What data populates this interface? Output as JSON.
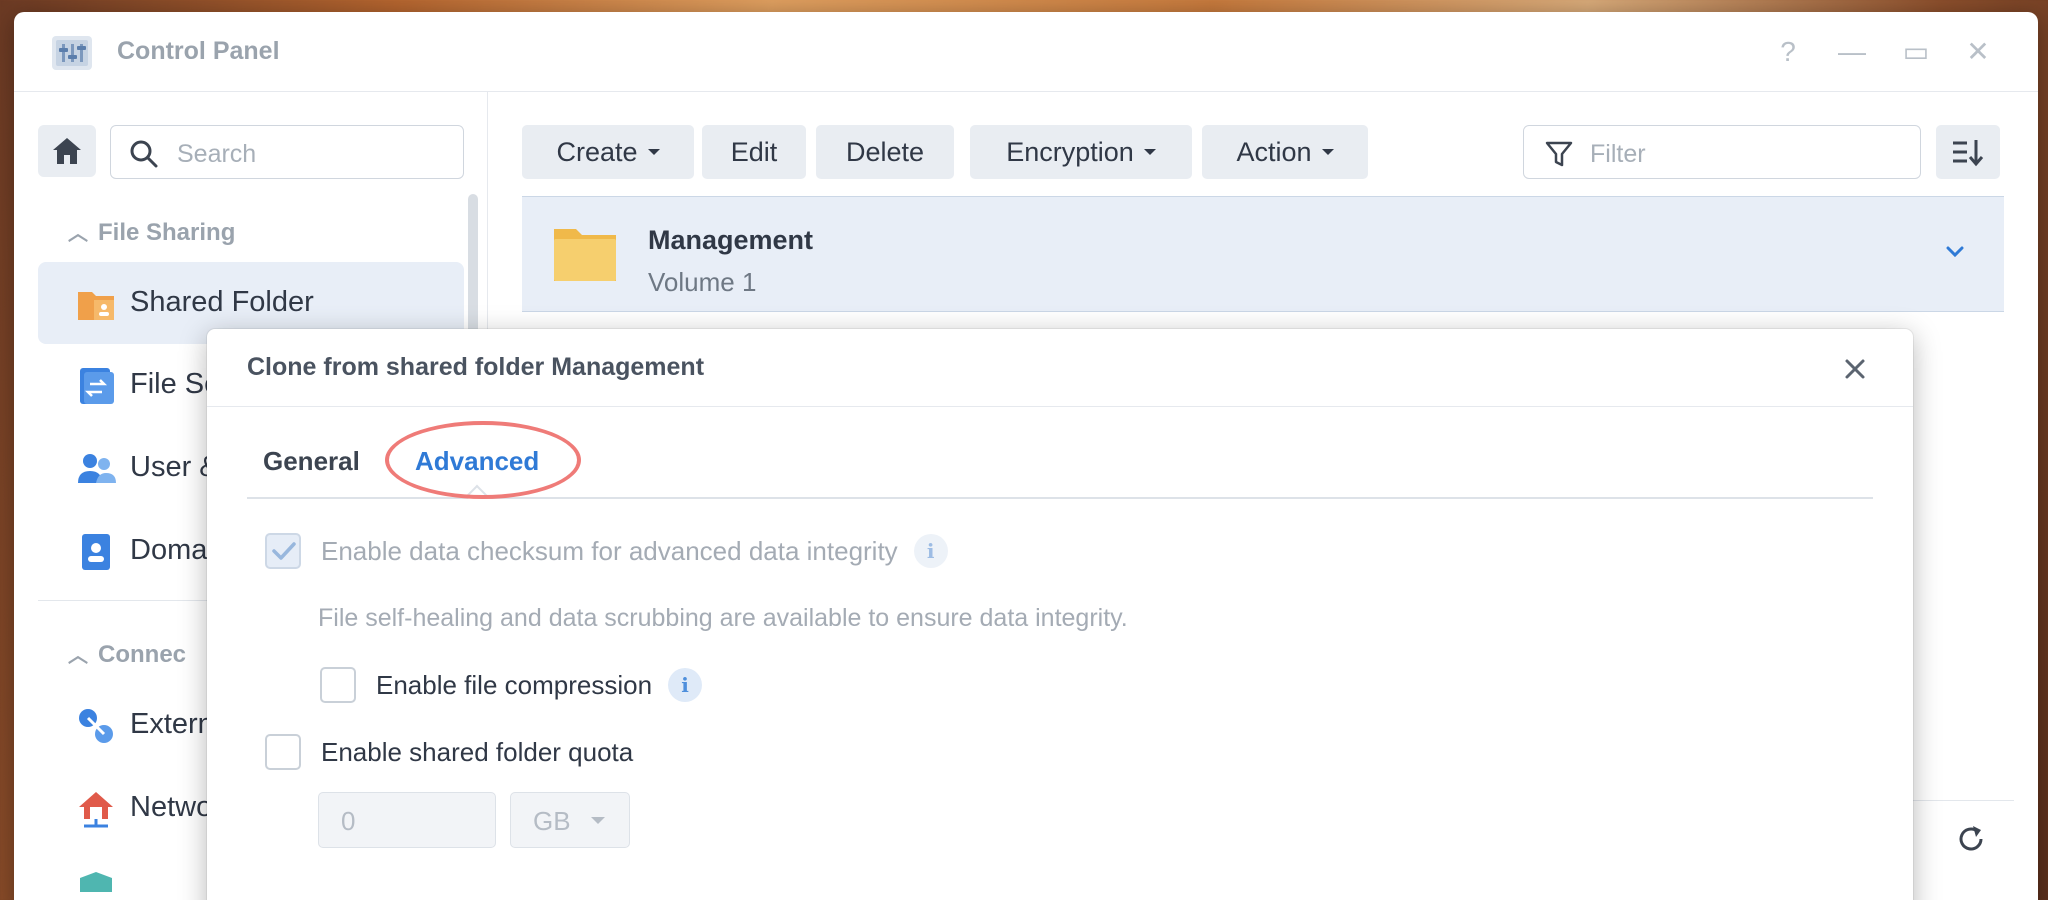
{
  "window": {
    "title": "Control Panel"
  },
  "window_controls": {
    "help": "?",
    "minimize": "—",
    "maximize": "▭",
    "close": "✕"
  },
  "sidebar": {
    "search_placeholder": "Search",
    "sections": [
      {
        "title": "File Sharing"
      },
      {
        "title": "Connec"
      }
    ],
    "items": [
      {
        "label": "Shared Folder",
        "icon": "shared-folder-icon",
        "active": true
      },
      {
        "label": "File Se",
        "icon": "file-services-icon"
      },
      {
        "label": "User &",
        "icon": "user-group-icon"
      },
      {
        "label": "Domai",
        "icon": "domain-ldap-icon"
      },
      {
        "label": "Extern",
        "icon": "external-access-icon"
      },
      {
        "label": "Networ",
        "icon": "network-icon"
      }
    ]
  },
  "toolbar": {
    "create": "Create",
    "edit": "Edit",
    "delete": "Delete",
    "encryption": "Encryption",
    "action": "Action",
    "filter_placeholder": "Filter"
  },
  "folder_list": [
    {
      "name": "Management",
      "volume": "Volume 1"
    }
  ],
  "dialog": {
    "title": "Clone from shared folder Management",
    "tabs": [
      "General",
      "Advanced"
    ],
    "active_tab": "Advanced",
    "options": {
      "checksum": {
        "label": "Enable data checksum for advanced data integrity",
        "checked": true,
        "disabled": true
      },
      "checksum_desc": "File self-healing and data scrubbing are available to ensure data integrity.",
      "compression": {
        "label": "Enable file compression",
        "checked": false
      },
      "quota": {
        "label": "Enable shared folder quota",
        "checked": false
      },
      "quota_value": "0",
      "quota_unit": "GB"
    }
  },
  "colors": {
    "accent": "#2f7ad6",
    "highlight_ring": "#ef7b78",
    "selected_row": "#e8eef7",
    "folder": "#f6c85f"
  }
}
